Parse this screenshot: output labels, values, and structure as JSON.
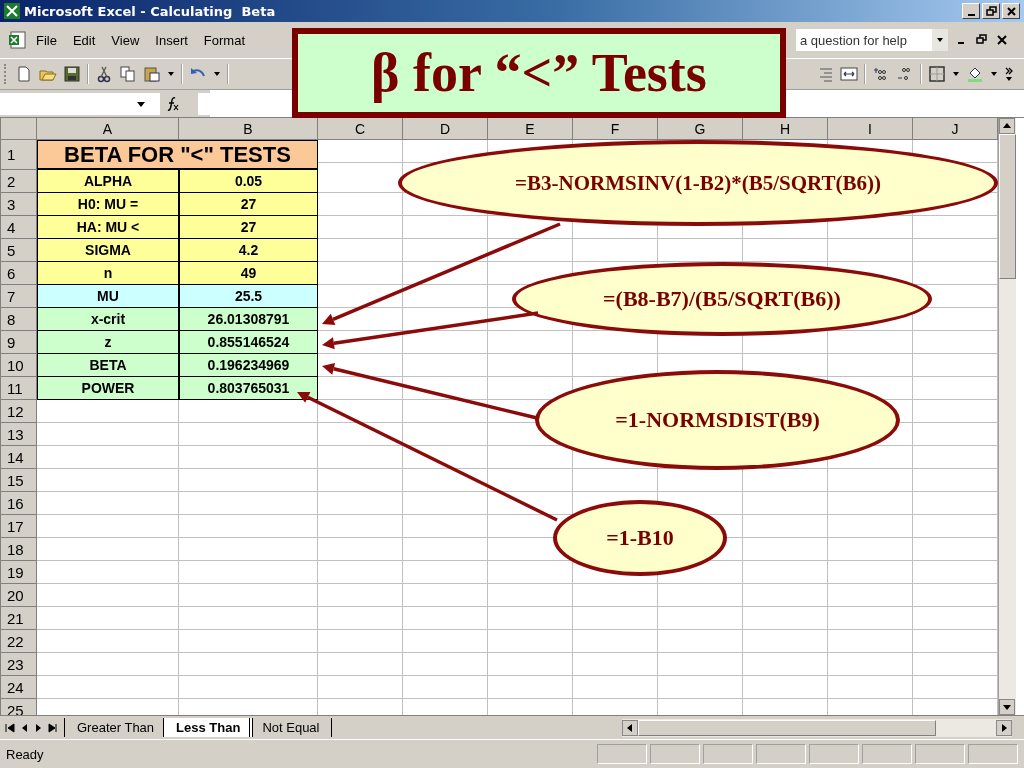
{
  "window": {
    "title": "Microsoft Excel - Calculating  Beta"
  },
  "menu": [
    {
      "label": "File"
    },
    {
      "label": "Edit"
    },
    {
      "label": "View"
    },
    {
      "label": "Insert"
    },
    {
      "label": "Format"
    }
  ],
  "help_box": {
    "placeholder": "a question for help"
  },
  "slide_title": "β for “<” Tests",
  "columns": [
    "A",
    "B",
    "C",
    "D",
    "E",
    "F",
    "G",
    "H",
    "I",
    "J"
  ],
  "rows": [
    {
      "number": "1",
      "kind": "title",
      "a": "BETA FOR \"<\" TESTS",
      "color": "#fbc898"
    },
    {
      "number": "2",
      "kind": "pair",
      "a": "ALPHA",
      "b": "0.05",
      "color": "#ffff99"
    },
    {
      "number": "3",
      "kind": "pair",
      "a": "H0:  MU =",
      "b": "27",
      "color": "#ffff99"
    },
    {
      "number": "4",
      "kind": "pair",
      "a": "HA: MU <",
      "b": "27",
      "color": "#ffff99"
    },
    {
      "number": "5",
      "kind": "pair",
      "a": "SIGMA",
      "b": "4.2",
      "color": "#ffff99"
    },
    {
      "number": "6",
      "kind": "pair",
      "a": "n",
      "b": "49",
      "color": "#ffff99"
    },
    {
      "number": "7",
      "kind": "pair",
      "a": "MU",
      "b": "25.5",
      "color": "#ccffff"
    },
    {
      "number": "8",
      "kind": "pair",
      "a": "x-crit",
      "b": "26.01308791",
      "color": "#ccffcc"
    },
    {
      "number": "9",
      "kind": "pair",
      "a": "z",
      "b": "0.855146524",
      "color": "#ccffcc"
    },
    {
      "number": "10",
      "kind": "pair",
      "a": "BETA",
      "b": "0.196234969",
      "color": "#ccffcc"
    },
    {
      "number": "11",
      "kind": "pair",
      "a": "POWER",
      "b": "0.803765031",
      "color": "#ccffcc"
    },
    {
      "number": "12",
      "kind": "empty"
    },
    {
      "number": "13",
      "kind": "empty"
    },
    {
      "number": "14",
      "kind": "empty"
    },
    {
      "number": "15",
      "kind": "empty"
    },
    {
      "number": "16",
      "kind": "empty"
    },
    {
      "number": "17",
      "kind": "empty"
    },
    {
      "number": "18",
      "kind": "empty"
    },
    {
      "number": "19",
      "kind": "empty"
    },
    {
      "number": "20",
      "kind": "empty"
    },
    {
      "number": "21",
      "kind": "empty"
    },
    {
      "number": "22",
      "kind": "empty"
    },
    {
      "number": "23",
      "kind": "empty"
    },
    {
      "number": "24",
      "kind": "empty"
    },
    {
      "number": "25",
      "kind": "empty"
    }
  ],
  "callouts": [
    {
      "text": "=B3-NORMSINV(1-B2)*(B5/SQRT(B6))"
    },
    {
      "text": "=(B8-B7)/(B5/SQRT(B6))"
    },
    {
      "text": "=1-NORMSDIST(B9)"
    },
    {
      "text": "=1-B10"
    }
  ],
  "sheet_tabs": [
    {
      "label": "Greater Than",
      "selected": false
    },
    {
      "label": "Less Than",
      "selected": true
    },
    {
      "label": "Not Equal",
      "selected": false
    }
  ],
  "status_bar": {
    "text": "Ready"
  }
}
